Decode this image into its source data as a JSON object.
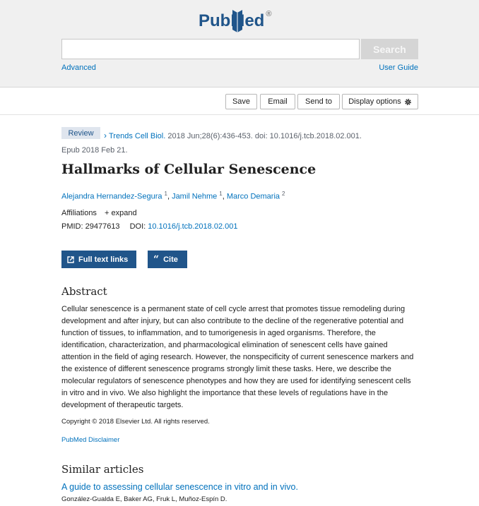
{
  "header": {
    "logo_pub": "Pub",
    "logo_med": "Med",
    "logo_reg": "®",
    "search_value": "",
    "search_button": "Search",
    "advanced_link": "Advanced",
    "user_guide_link": "User Guide"
  },
  "actions": {
    "save": "Save",
    "email": "Email",
    "send_to": "Send to",
    "display_options": "Display options"
  },
  "article": {
    "type_badge": "Review",
    "journal": "Trends Cell Biol.",
    "citation": " 2018 Jun;28(6):436-453. doi: 10.1016/j.tcb.2018.02.001.",
    "epub": "Epub 2018 Feb 21.",
    "title": "Hallmarks of Cellular Senescence",
    "authors": [
      {
        "name": "Alejandra Hernandez-Segura",
        "aff": "1"
      },
      {
        "name": "Jamil Nehme",
        "aff": "1"
      },
      {
        "name": "Marco Demaria",
        "aff": "2"
      }
    ],
    "affiliations_label": "Affiliations",
    "expand_label": "+ expand",
    "pmid_label": "PMID: 29477613",
    "doi_label": "DOI:",
    "doi_value": "10.1016/j.tcb.2018.02.001"
  },
  "buttons": {
    "full_text": "Full text links",
    "cite": "Cite"
  },
  "abstract": {
    "heading": "Abstract",
    "text": "Cellular senescence is a permanent state of cell cycle arrest that promotes tissue remodeling during development and after injury, but can also contribute to the decline of the regenerative potential and function of tissues, to inflammation, and to tumorigenesis in aged organisms. Therefore, the identification, characterization, and pharmacological elimination of senescent cells have gained attention in the field of aging research. However, the nonspecificity of current senescence markers and the existence of different senescence programs strongly limit these tasks. Here, we describe the molecular regulators of senescence phenotypes and how they are used for identifying senescent cells in vitro and in vivo. We also highlight the importance that these levels of regulations have in the development of therapeutic targets.",
    "copyright": "Copyright © 2018 Elsevier Ltd. All rights reserved.",
    "disclaimer": "PubMed Disclaimer"
  },
  "similar": {
    "heading": "Similar articles",
    "items": [
      {
        "title": "A guide to assessing cellular senescence in vitro and in vivo.",
        "authors": "González-Gualda E, Baker AG, Fruk L, Muñoz-Espín D."
      }
    ]
  },
  "colors": {
    "brand": "#20558a",
    "link": "#0071bc",
    "badge_bg": "#dfe5ee"
  }
}
